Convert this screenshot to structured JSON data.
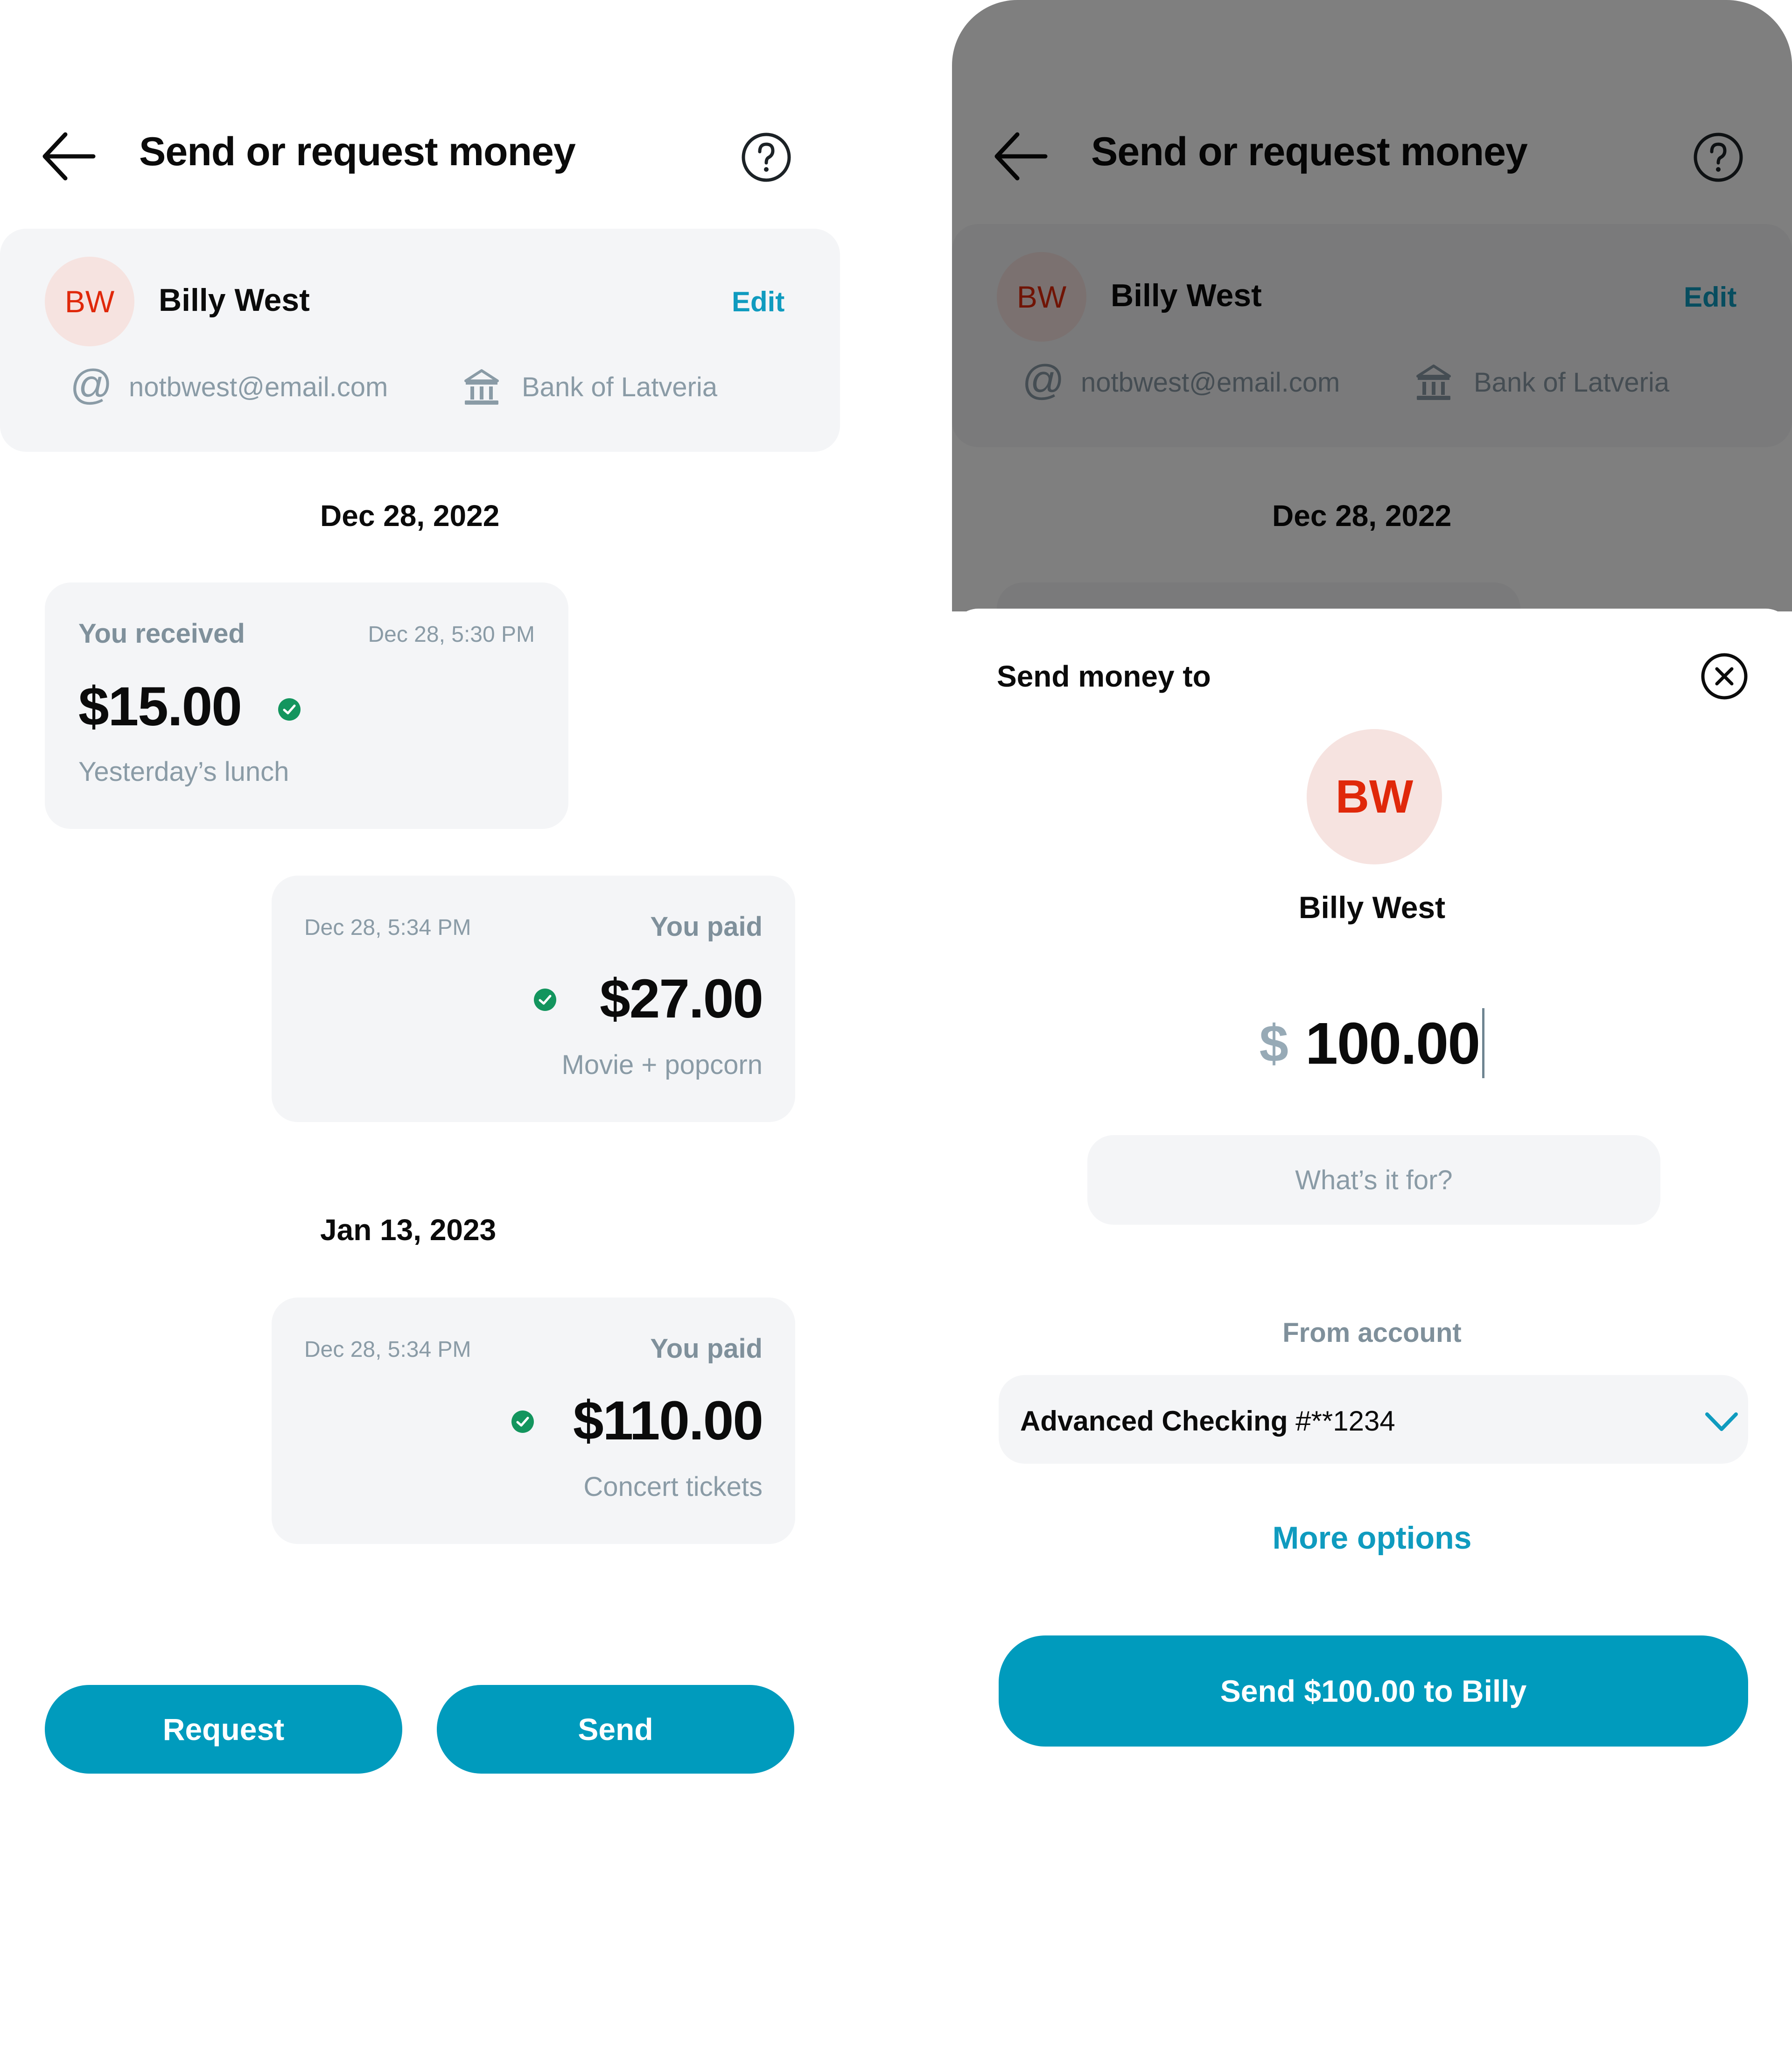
{
  "header": {
    "title": "Send or request money",
    "back_icon": "arrow-left-icon",
    "help_icon": "question-circle-icon"
  },
  "contact": {
    "initials": "BW",
    "name": "Billy West",
    "edit_label": "Edit",
    "email_icon": "at-icon",
    "email": "notbwest@email.com",
    "bank_icon": "bank-icon",
    "bank": "Bank of Latveria"
  },
  "history": {
    "groups": [
      {
        "date": "Dec 28, 2022",
        "transactions": [
          {
            "direction": "received",
            "kind": "You received",
            "time": "Dec 28, 5:30 PM",
            "amount": "$15.00",
            "status": "completed",
            "note": "Yesterday’s lunch"
          },
          {
            "direction": "paid",
            "kind": "You paid",
            "time": "Dec 28, 5:34 PM",
            "amount": "$27.00",
            "status": "completed",
            "note": "Movie + popcorn"
          }
        ]
      },
      {
        "date": "Jan 13, 2023",
        "transactions": [
          {
            "direction": "paid",
            "kind": "You paid",
            "time": "Dec 28, 5:34 PM",
            "amount": "$110.00",
            "status": "completed",
            "note": "Concert tickets"
          }
        ]
      }
    ]
  },
  "actions": {
    "request_label": "Request",
    "send_label": "Send"
  },
  "send_sheet": {
    "title": "Send money to",
    "close_icon": "close-circle-icon",
    "recipient_initials": "BW",
    "recipient_name": "Billy West",
    "currency_symbol": "$",
    "amount": "100.00",
    "note_value": "",
    "note_placeholder": "What’s it for?",
    "from_label": "From account",
    "account_name": "Advanced Checking",
    "account_number": "#**1234",
    "more_options_label": "More options",
    "submit_label": "Send $100.00 to Billy"
  },
  "colors": {
    "accent": "#009bbd",
    "link": "#0f9bbf",
    "avatar_bg": "#f6e3e0",
    "avatar_text": "#e0280a",
    "success": "#13955e",
    "card_bg": "#f4f5f7",
    "muted_text": "#8a9ba6",
    "scrim": "rgba(0,0,0,0.5)"
  }
}
